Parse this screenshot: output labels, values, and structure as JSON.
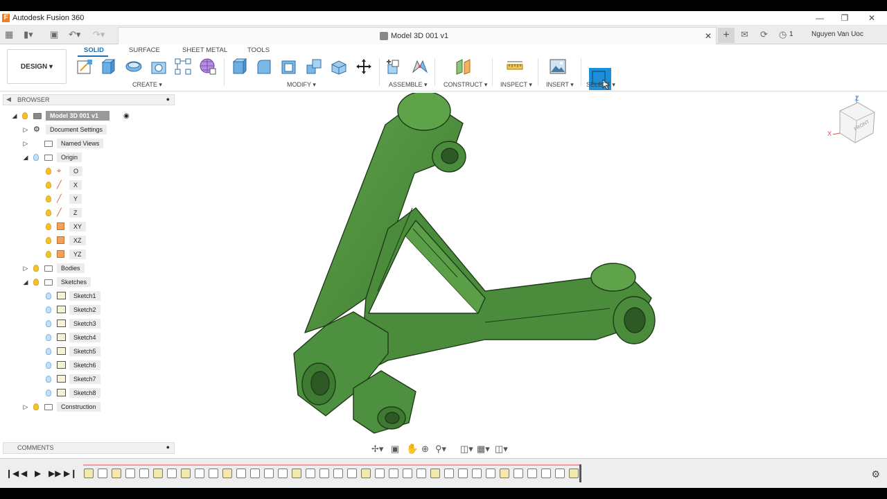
{
  "window": {
    "title": "Autodesk Fusion 360",
    "logo_letter": "F"
  },
  "appbar": {
    "doc_title": "Model 3D 001 v1",
    "job_count": "1",
    "user_name": "Nguyen Van Uoc"
  },
  "ribbon": {
    "workspace": "DESIGN",
    "tabs": [
      "SOLID",
      "SURFACE",
      "SHEET METAL",
      "TOOLS"
    ],
    "groups": [
      "CREATE",
      "MODIFY",
      "ASSEMBLE",
      "CONSTRUCT",
      "INSPECT",
      "INSERT",
      "SELECT"
    ]
  },
  "browser": {
    "title": "BROWSER",
    "root": "Model 3D 001 v1",
    "items": [
      "Document Settings",
      "Named Views",
      "Origin",
      "O",
      "X",
      "Y",
      "Z",
      "XY",
      "XZ",
      "YZ",
      "Bodies",
      "Sketches",
      "Sketch1",
      "Sketch2",
      "Sketch3",
      "Sketch4",
      "Sketch5",
      "Sketch6",
      "Sketch7",
      "Sketch8",
      "Construction"
    ]
  },
  "comments": {
    "title": "COMMENTS"
  },
  "viewcube": {
    "face": "FRONT",
    "axis_z": "Z",
    "axis_x": "X"
  },
  "colors": {
    "accent": "#1c6fb5",
    "model_green": "#4f8f3f",
    "model_dark": "#2d5a24"
  },
  "icons": [
    "grid-icon",
    "file-icon",
    "save-icon",
    "undo-icon",
    "redo-icon",
    "close-icon",
    "plus-icon",
    "chat-icon",
    "help-icon",
    "clock-icon",
    "gear-icon"
  ]
}
